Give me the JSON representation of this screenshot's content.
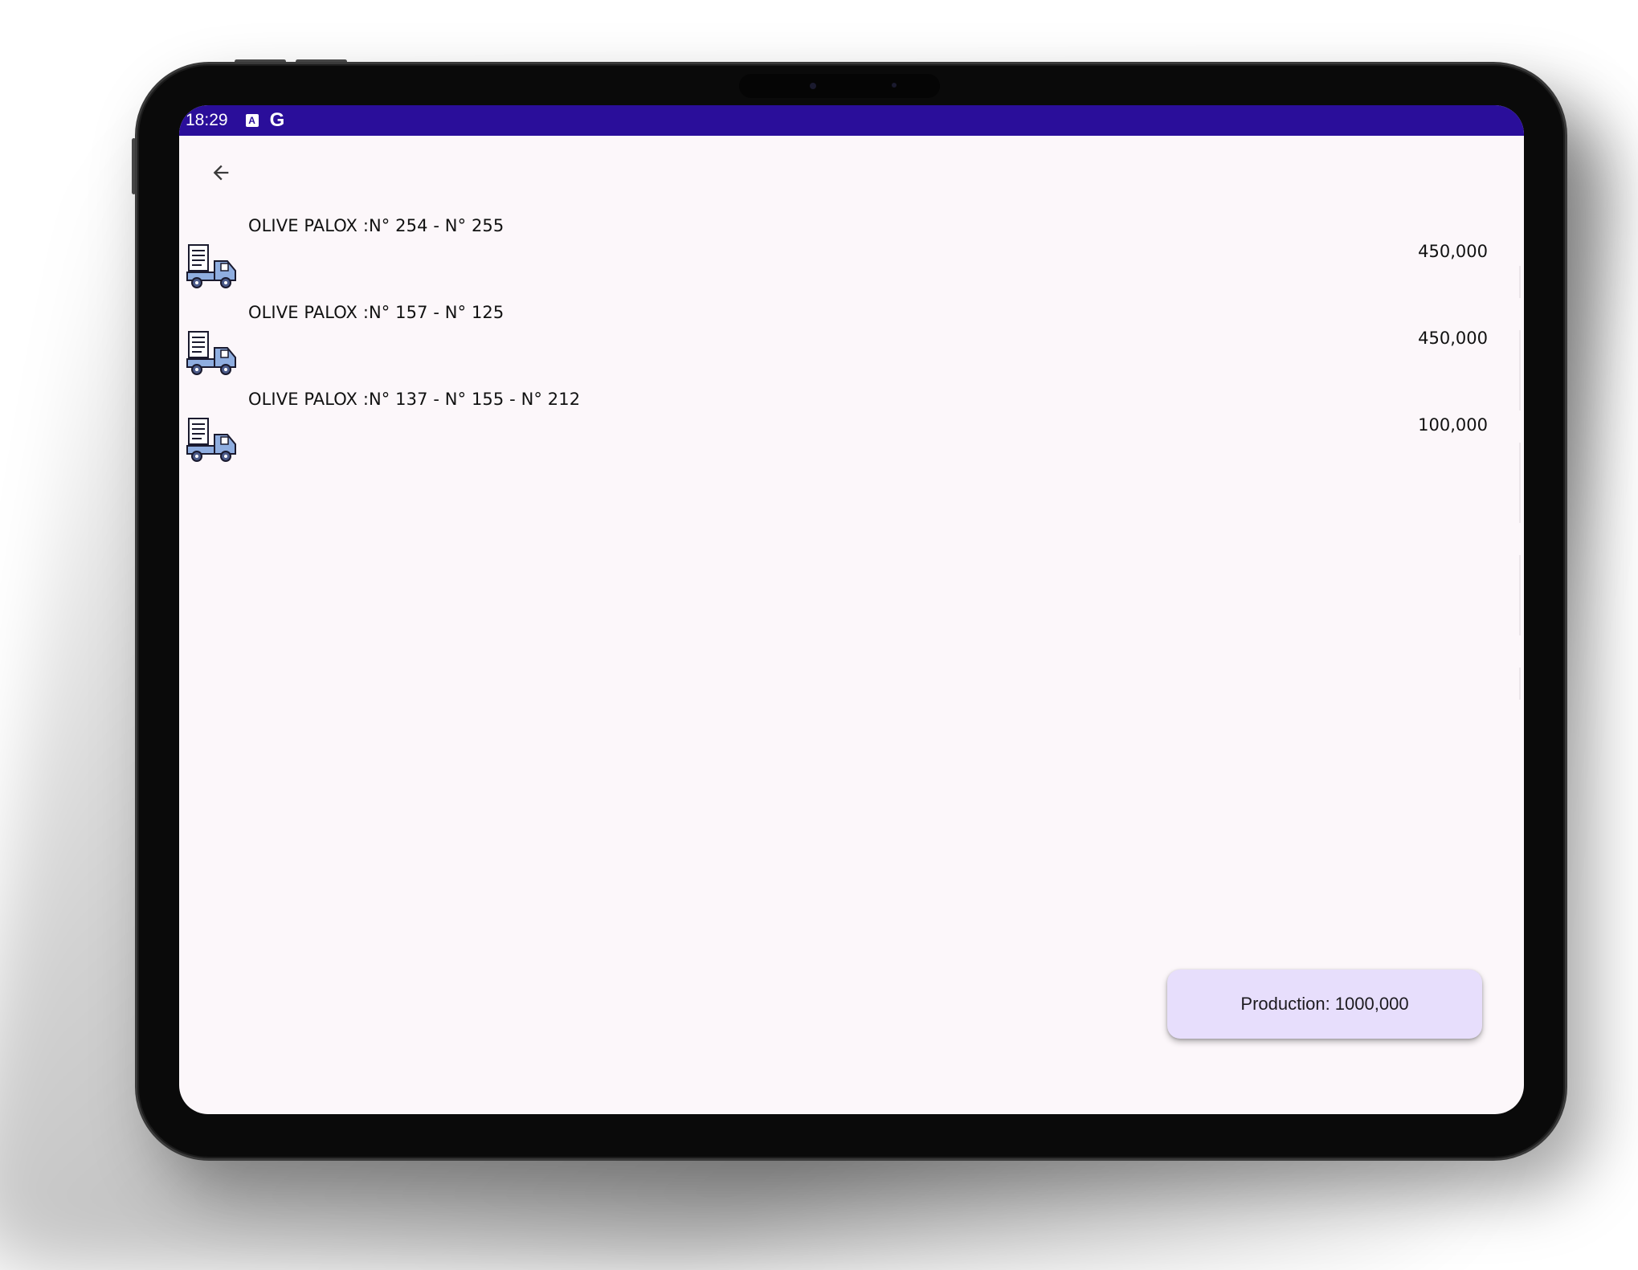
{
  "status_bar": {
    "time": "18:29",
    "icons": [
      "keyboard-a-icon",
      "google-g-icon"
    ],
    "a_glyph": "A",
    "g_glyph": "G",
    "background_color": "#2a0e9a"
  },
  "toolbar": {
    "back_icon": "arrow-left-icon"
  },
  "list": {
    "items": [
      {
        "icon": "delivery-truck-icon",
        "title": "OLIVE  PALOX :N° 254 - N° 255",
        "value": "450,000"
      },
      {
        "icon": "delivery-truck-icon",
        "title": "OLIVE  PALOX :N° 157 - N° 125",
        "value": "450,000"
      },
      {
        "icon": "delivery-truck-icon",
        "title": "OLIVE  PALOX :N° 137 - N° 155 - N° 212",
        "value": "100,000"
      }
    ]
  },
  "production_button": {
    "label": "Production: 1000,000",
    "background_color": "#e7defc"
  },
  "colors": {
    "screen_background": "#fcf7fa",
    "text": "#111111"
  }
}
